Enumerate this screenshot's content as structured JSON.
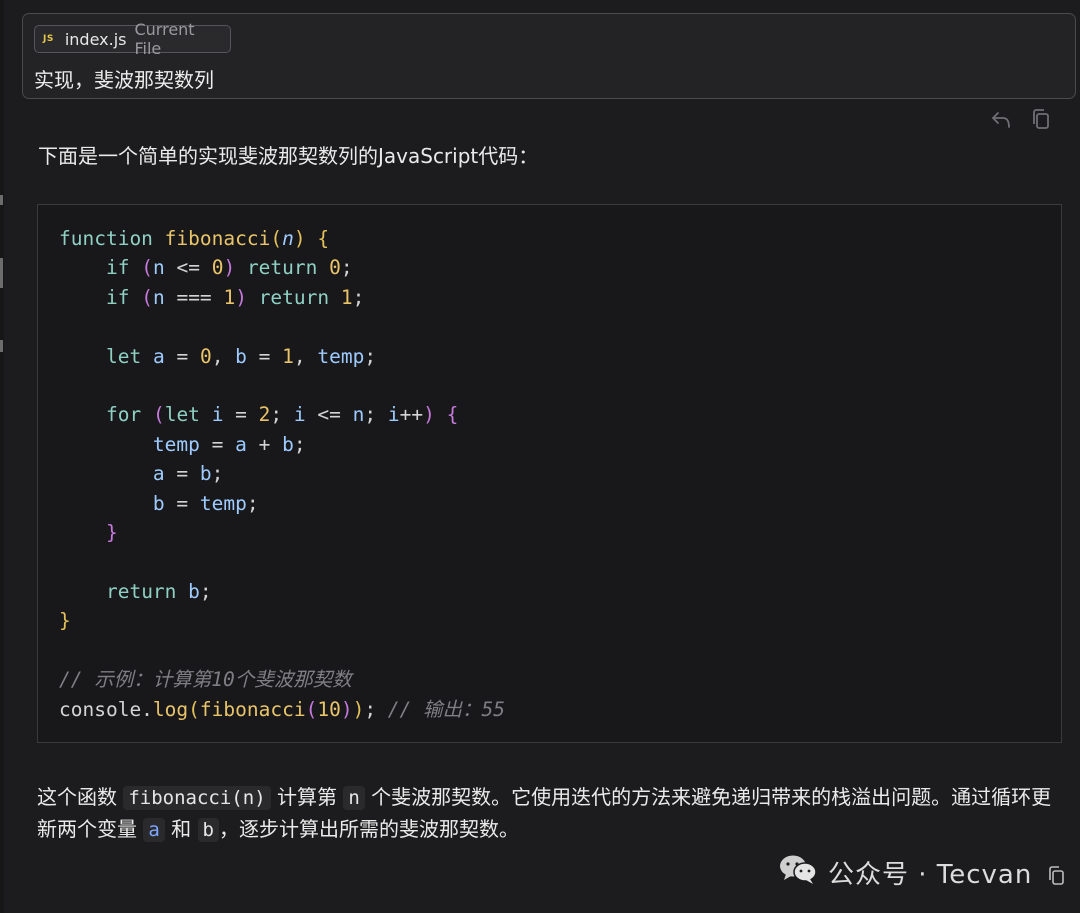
{
  "prompt": {
    "file_chip": {
      "icon_label": "JS",
      "file_name": "index.js",
      "tag": "Current File"
    },
    "text": "实现，斐波那契数列"
  },
  "actions": {
    "undo_icon": "undo-icon",
    "copy_icon": "copy-icon"
  },
  "response": {
    "intro": "下面是一个简单的实现斐波那契数列的JavaScript代码：",
    "code_language": "javascript",
    "explain": {
      "p1": "这个函数",
      "c1": "fibonacci(n)",
      "p2": "计算第",
      "c2": "n",
      "p3": "个斐波那契数。它使用迭代的方法来避免递归带来的栈溢出问题。通过循环更新两个变量",
      "c3": "a",
      "p4": "和",
      "c4": "b",
      "p5": "，逐步计算出所需的斐波那契数。"
    }
  },
  "watermark": {
    "text": "公众号 · Tecvan"
  },
  "colors": {
    "background": "#1c1c1e",
    "code_bg": "#18181a",
    "keyword": "#8fd0c4",
    "function": "#e9c46a",
    "variable": "#9ecbff",
    "comment": "#7e7e84"
  }
}
